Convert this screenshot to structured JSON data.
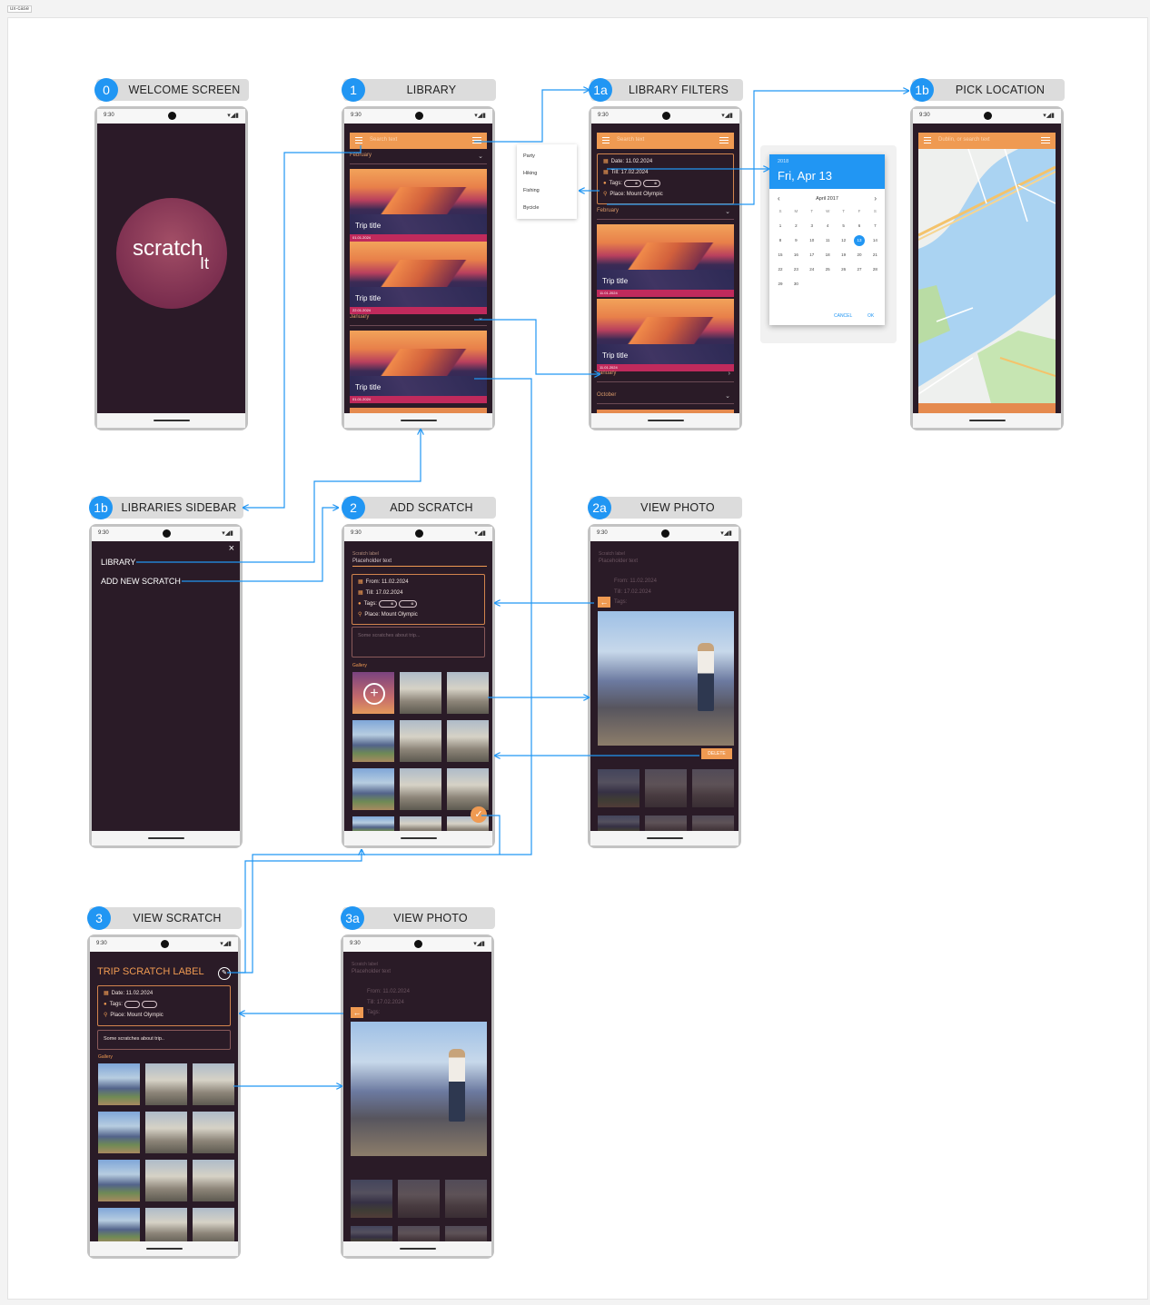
{
  "board_tag": "ux-case",
  "status": {
    "time": "9:30",
    "icons": "▾◢▮"
  },
  "headers": {
    "welcome": {
      "num": "0",
      "title": "WELCOME SCREEN"
    },
    "library": {
      "num": "1",
      "title": "LIBRARY"
    },
    "filters": {
      "num": "1a",
      "title": "LIBRARY FILTERS"
    },
    "location": {
      "num": "1b",
      "title": "PICK LOCATION"
    },
    "sidebar": {
      "num": "1b",
      "title": "LIBRARIES SIDEBAR"
    },
    "add": {
      "num": "2",
      "title": "ADD SCRATCH"
    },
    "photo2a": {
      "num": "2a",
      "title": "VIEW PHOTO"
    },
    "view": {
      "num": "3",
      "title": "VIEW SCRATCH"
    },
    "photo3a": {
      "num": "3a",
      "title": "VIEW PHOTO"
    }
  },
  "welcome": {
    "logo_main": "scratch",
    "logo_sub": "It"
  },
  "library": {
    "search_placeholder": "Search text",
    "sections": [
      "February",
      "January"
    ],
    "cards": [
      {
        "title": "Trip title",
        "date": "01.01.2024"
      },
      {
        "title": "Trip title",
        "date": "22.01.2024"
      },
      {
        "title": "Trip title",
        "date": "01.01.2024"
      }
    ]
  },
  "tag_menu": [
    "Party",
    "Hiking",
    "Fishing",
    "Bycicle"
  ],
  "filters": {
    "search_placeholder": "Search text",
    "date": "Date: 11.02.2024",
    "till": "Till: 17.02.2024",
    "tags": "Tags:",
    "place": "Place: Mount Olympic",
    "sections": [
      "February",
      "January",
      "October"
    ],
    "cards": [
      {
        "title": "Trip title",
        "date": "11.01.2024"
      },
      {
        "title": "Trip title",
        "date": "11.01.2024"
      }
    ]
  },
  "datepicker": {
    "year": "2018",
    "date": "Fri, Apr 13",
    "month": "April 2017",
    "weekdays": [
      "S",
      "M",
      "T",
      "W",
      "T",
      "F",
      "S"
    ],
    "days": [
      "1",
      "2",
      "3",
      "4",
      "5",
      "6",
      "7",
      "8",
      "9",
      "10",
      "11",
      "12",
      "13",
      "14",
      "15",
      "16",
      "17",
      "18",
      "19",
      "20",
      "21",
      "22",
      "23",
      "24",
      "25",
      "26",
      "27",
      "28",
      "29",
      "30"
    ],
    "selected": "13",
    "cancel": "CANCEL",
    "ok": "OK"
  },
  "location": {
    "search_placeholder": "Dublin, or search text"
  },
  "sidebar": {
    "items": [
      "LIBRARY",
      "ADD NEW SCRATCH"
    ],
    "close": "×"
  },
  "add_scratch": {
    "label": "Scratch label",
    "placeholder": "Placeholder text",
    "from": "From: 11.02.2024",
    "till": "Till: 17.02.2024",
    "tags": "Tags:",
    "place": "Place: Mount Olympic",
    "notes_placeholder": "Some scratches about trip...",
    "gallery": "Gallery"
  },
  "view_photo": {
    "delete": "DELETE",
    "ghost_label": "Scratch label",
    "ghost_placeholder": "Placeholder text",
    "ghost_from": "From: 11.02.2024",
    "ghost_till": "Till: 17.02.2024",
    "ghost_tags": "Tags:"
  },
  "view_scratch": {
    "title": "TRIP SCRATCH LABEL",
    "date": "Date: 11.02.2024",
    "tags": "Tags:",
    "place": "Place: Mount Olympic",
    "notes": "Some scratches about trip..",
    "gallery": "Gallery"
  },
  "colors": {
    "accent": "#ef9a52",
    "badge": "#2196f3",
    "screen_bg": "#2a1b27",
    "connector": "#2196f3"
  }
}
